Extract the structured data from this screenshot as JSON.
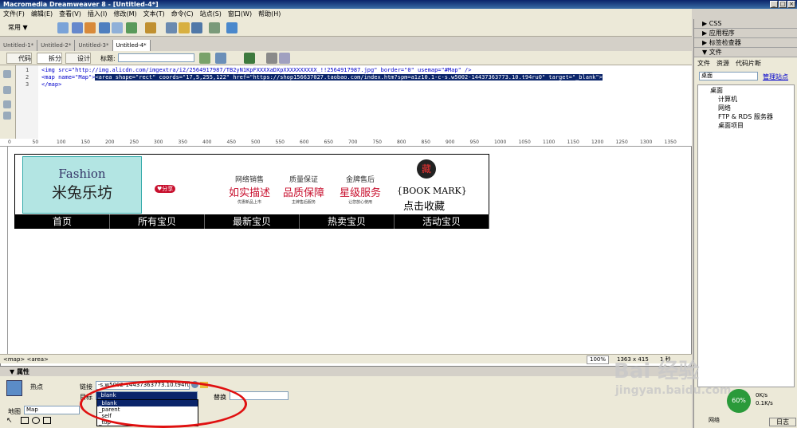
{
  "window": {
    "title": "Macromedia Dreamweaver 8 - [Untitled-4*]"
  },
  "menu": [
    "文件(F)",
    "编辑(E)",
    "查看(V)",
    "插入(I)",
    "修改(M)",
    "文本(T)",
    "命令(C)",
    "站点(S)",
    "窗口(W)",
    "帮助(H)"
  ],
  "toolbar": {
    "category": "常用"
  },
  "tabs": [
    "Untitled-1*",
    "Untitled-2*",
    "Untitled-3*",
    "Untitled-4*"
  ],
  "doctools": {
    "code": "代码",
    "split": "拆分",
    "design": "设计",
    "title_label": "标题:"
  },
  "code": {
    "line1_num": "1",
    "line2_num": "2",
    "line3_num": "3",
    "line1": "<img src=\"http://img.alicdn.com/imgextra/i2/2564917987/TB2yN1KpFXXXXaDXpXXXXXXXXXX_!!2564917987.jpg\" border=\"0\" usemap=\"#Map\" />",
    "line2_pre": "<map name=\"Map\">",
    "line2_sel": "<area shape=\"rect\" coords=\"17,5,255,122\" href=\"https://shop156637027.taobao.com/index.htm?spm=a1z10.1-c-s.w5002-14437363773.10.t94ru0\" target=\"_blank\">",
    "line3": "</map>"
  },
  "ruler_ticks": [
    "0",
    "50",
    "100",
    "150",
    "200",
    "250",
    "300",
    "350",
    "400",
    "450",
    "500",
    "550",
    "600",
    "650",
    "700",
    "750",
    "800",
    "850",
    "900",
    "950",
    "1000",
    "1050",
    "1100",
    "1150",
    "1200",
    "1250",
    "1300",
    "1350"
  ],
  "banner": {
    "logo_en": "Fashion",
    "logo_cn": "米兔乐坊",
    "share": "♥分享",
    "features": [
      {
        "small": "网络销售",
        "big": "如实描述",
        "sub": "优惠新品上市"
      },
      {
        "small": "质量保证",
        "big": "品质保障",
        "sub": "主牌售后服务"
      },
      {
        "small": "金牌售后",
        "big": "星级服务",
        "sub": "让您放心使用"
      }
    ],
    "seal": "藏",
    "bookmark": "{BOOK MARK}",
    "collect": "点击收藏",
    "nav": [
      "首页",
      "所有宝贝",
      "最新宝贝",
      "热卖宝贝",
      "活动宝贝"
    ]
  },
  "statusbar": {
    "tags": "<map> <area>",
    "zoom": "100%",
    "size": "1363 x 415",
    "info": "1 秒"
  },
  "properties": {
    "header": "▼ 属性",
    "hotspot_label": "热点",
    "link_label": "链接",
    "link_value": "-s.w5002-14437363773.10.t94ru0",
    "target_label": "目标",
    "target_value": "_blank",
    "alt_label": "替换",
    "map_label": "地图",
    "map_value": "Map",
    "options": [
      "_blank",
      "_parent",
      "_self",
      "_top"
    ]
  },
  "right_panel": {
    "sections": [
      "▶ CSS",
      "▶ 应用程序",
      "▶ 标签检查器",
      "▼ 文件"
    ],
    "file_tabs": [
      "文件",
      "资源",
      "代码片断"
    ],
    "location": "桌面",
    "manage": "管理站点",
    "tree": [
      "桌面",
      "计算机",
      "网络",
      "FTP & RDS 服务器",
      "桌面项目"
    ],
    "net_label": "网络",
    "log": "日志"
  },
  "watermark": {
    "text": "Bai 经验",
    "url": "jingyan.baidu.com"
  },
  "net_speed": {
    "up": "0K/s",
    "down": "0.1K/s",
    "percent": "60%"
  }
}
